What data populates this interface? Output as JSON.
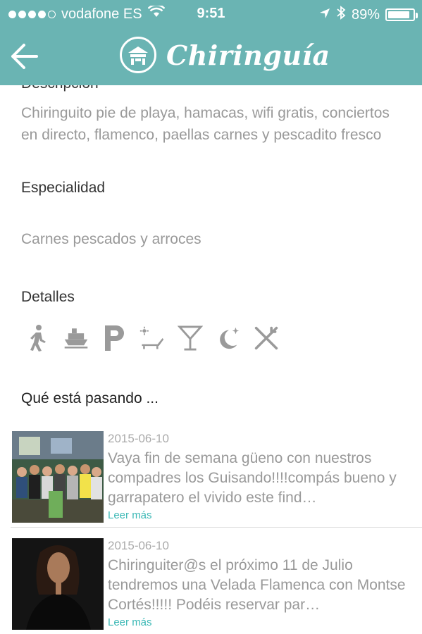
{
  "status": {
    "carrier": "vodafone ES",
    "time": "9:51",
    "battery": "89%",
    "battery_level": 0.89,
    "signal_dots": 5,
    "signal_filled": 4
  },
  "header": {
    "title": "Chiringuía",
    "back_icon": "back-arrow-icon",
    "logo_icon": "beach-hut-icon",
    "color": "#6ab4b3"
  },
  "sections": {
    "description_title": "Descripción",
    "description_text": "Chiringuito pie de playa, hamacas, wifi gratis, conciertos en directo, flamenco, paellas carnes  y pescadito fresco",
    "specialty_title": "Especialidad",
    "specialty_text": "Carnes pescados y arroces",
    "details_title": "Detalles",
    "details_icons": [
      "walk-icon",
      "boat-icon",
      "parking-icon",
      "sunbed-icon",
      "cocktail-icon",
      "night-icon",
      "restaurant-icon"
    ],
    "happening_title": "Qué está pasando ..."
  },
  "news": [
    {
      "date": "2015-06-10",
      "text": "Vaya fin de semana güeno con nuestros compadres los Guisando!!!!compás bueno y garrapatero el vivido este find…",
      "more": "Leer más"
    },
    {
      "date": "2015-06-10",
      "text": "Chiringuiter@s el próximo 11 de Julio tendremos una Velada Flamenca con Montse Cortés!!!!! Podéis reservar par…",
      "more": "Leer más"
    }
  ]
}
